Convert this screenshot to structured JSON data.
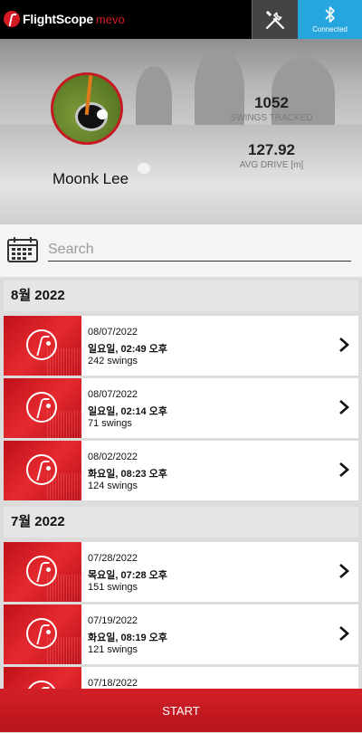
{
  "topbar": {
    "brand": "FlightScope",
    "brand_sub": "mevo",
    "tools_icon": "wrench-screwdriver-icon",
    "bluetooth_icon": "bluetooth-icon",
    "bluetooth_status": "Connected",
    "bluetooth_color": "#27a5de"
  },
  "profile": {
    "name": "Moonk Lee",
    "swings_value": "1052",
    "swings_label": "SWINGS TRACKED",
    "drive_value": "127.92",
    "drive_label": "AVG DRIVE [m]"
  },
  "search": {
    "placeholder": "Search",
    "calendar_icon": "calendar-icon"
  },
  "sessions": {
    "groups": [
      {
        "month": "8월 2022",
        "items": [
          {
            "date": "08/07/2022",
            "time": "일요일, 02:49 오후",
            "swings": "242 swings"
          },
          {
            "date": "08/07/2022",
            "time": "일요일, 02:14 오후",
            "swings": "71 swings"
          },
          {
            "date": "08/02/2022",
            "time": "화요일, 08:23 오후",
            "swings": "124 swings"
          }
        ]
      },
      {
        "month": "7월 2022",
        "items": [
          {
            "date": "07/28/2022",
            "time": "목요일, 07:28 오후",
            "swings": "151 swings"
          },
          {
            "date": "07/19/2022",
            "time": "화요일, 08:19 오후",
            "swings": "121 swings"
          },
          {
            "date": "07/18/2022",
            "time": "",
            "swings": ""
          }
        ]
      }
    ]
  },
  "footer": {
    "start_label": "START",
    "accent": "#d21f27"
  }
}
